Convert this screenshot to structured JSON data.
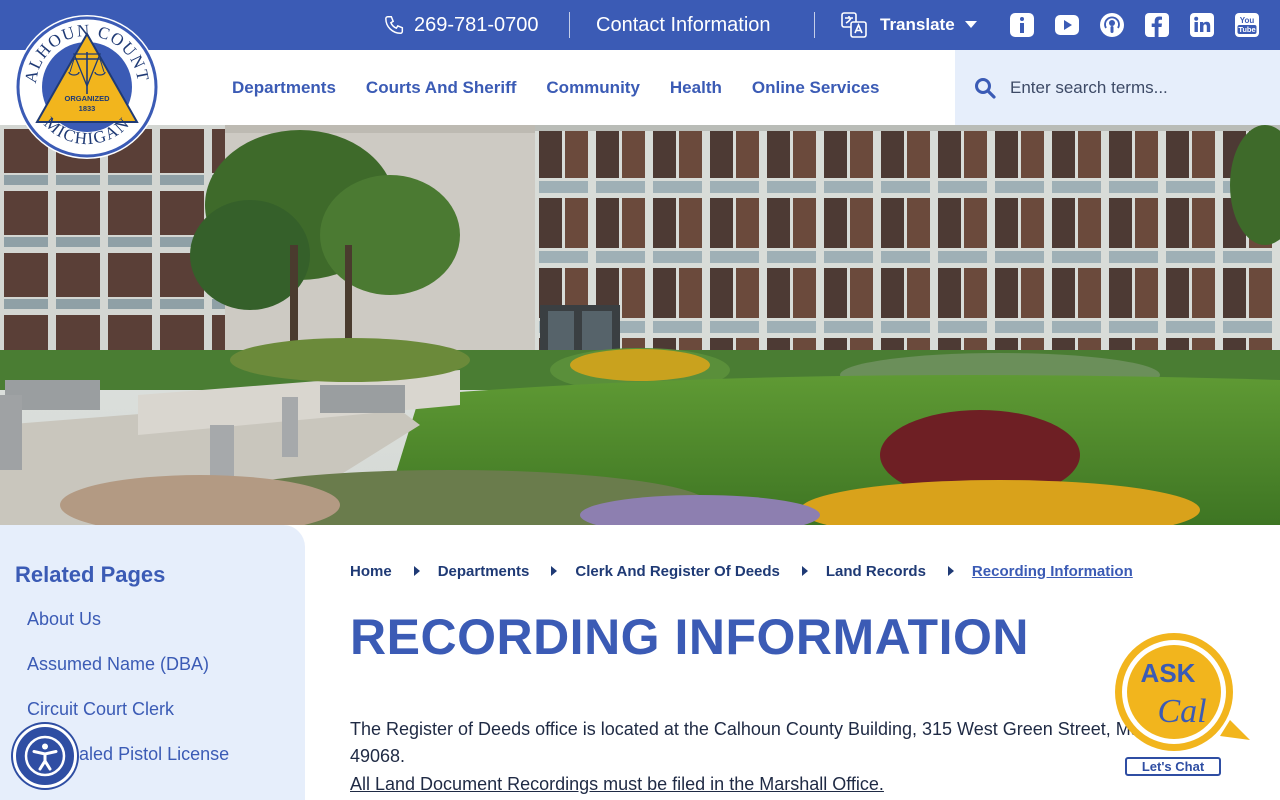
{
  "topbar": {
    "phone": "269-781-0700",
    "contact": "Contact Information",
    "translate": "Translate"
  },
  "logo": {
    "top_text": "CALHOUN COUNTY",
    "bottom_text": "MICHIGAN",
    "center_text": "ORGANIZED",
    "year": "1833"
  },
  "nav": {
    "items": [
      "Departments",
      "Courts And Sheriff",
      "Community",
      "Health",
      "Online Services"
    ]
  },
  "search": {
    "placeholder": "Enter search terms..."
  },
  "sidebar": {
    "title": "Related Pages",
    "items": [
      "About Us",
      "Assumed Name (DBA)",
      "Circuit Court Clerk",
      "Concealed Pistol License"
    ]
  },
  "breadcrumb": [
    "Home",
    "Departments",
    "Clerk And Register Of Deeds",
    "Land Records",
    "Recording Information"
  ],
  "page": {
    "title": "RECORDING INFORMATION",
    "paragraph": "The Register of Deeds office is located at the Calhoun County Building, 315 West Green Street, Marshall, MI 49068.",
    "notice": "All Land Document Recordings must be filed in the Marshall Office."
  },
  "askcal": {
    "line1": "ASK",
    "line2": "Cal",
    "chat": "Let's Chat"
  },
  "colors": {
    "brand_blue": "#3b5bb5",
    "light_blue": "#e6eefb",
    "gold": "#f2b51d",
    "navy": "#1f3a75"
  },
  "icons": [
    "phone-icon",
    "translate-icon",
    "info-icon",
    "youtube-icon",
    "podcast-icon",
    "facebook-icon",
    "linkedin-icon",
    "youtube-text-icon",
    "search-icon",
    "accessibility-icon"
  ]
}
